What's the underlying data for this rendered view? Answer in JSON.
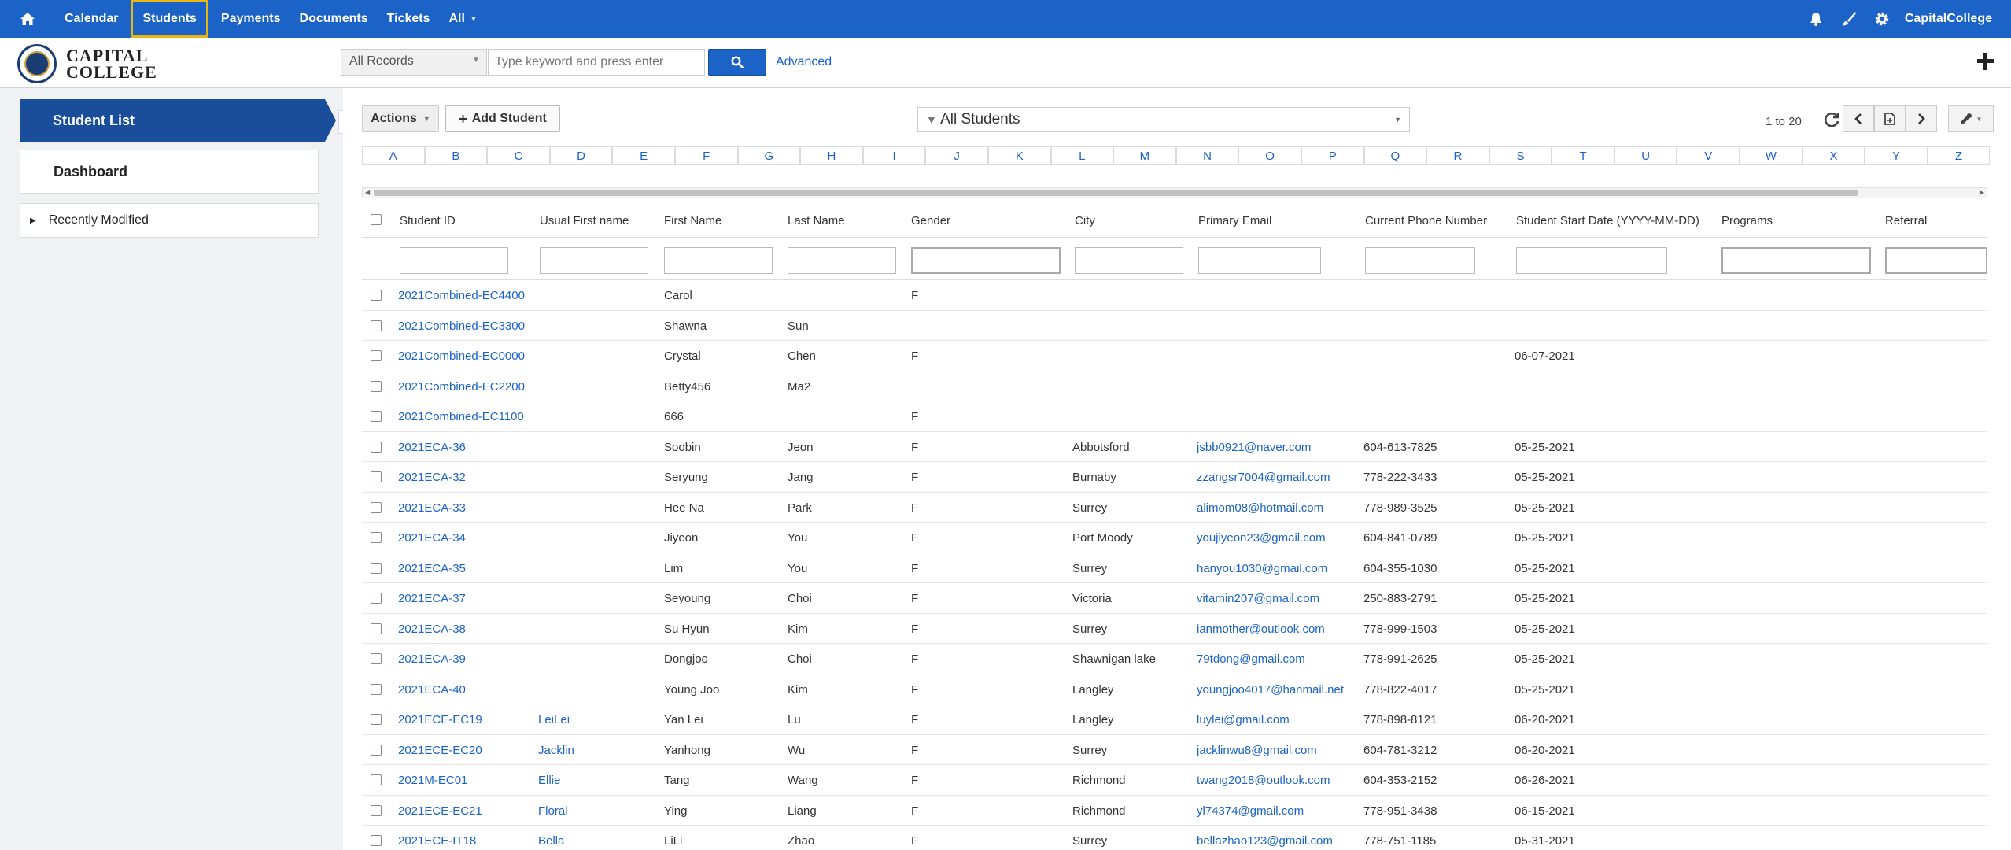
{
  "topnav": {
    "items": [
      {
        "label": "Calendar"
      },
      {
        "label": "Students"
      },
      {
        "label": "Payments"
      },
      {
        "label": "Documents"
      },
      {
        "label": "Tickets"
      },
      {
        "label": "All"
      }
    ],
    "org": "CapitalCollege",
    "active_outline_color": "#e8b512",
    "bar_color": "#1b63c6"
  },
  "logo": {
    "line1": "CAPITAL",
    "line2": "COLLEGE"
  },
  "search": {
    "record_type": "All Records",
    "placeholder": "Type keyword and press enter",
    "advanced": "Advanced"
  },
  "sidebar": {
    "active": "Student List",
    "dashboard": "Dashboard",
    "recent": "Recently Modified"
  },
  "toolbar": {
    "actions": "Actions",
    "add": "Add Student",
    "filter": "All Students",
    "range": "1 to 20"
  },
  "letters": [
    "A",
    "B",
    "C",
    "D",
    "E",
    "F",
    "G",
    "H",
    "I",
    "J",
    "K",
    "L",
    "M",
    "N",
    "O",
    "P",
    "Q",
    "R",
    "S",
    "T",
    "U",
    "V",
    "W",
    "X",
    "Y",
    "Z"
  ],
  "columns": {
    "student_id": "Student ID",
    "usual_first": "Usual First name",
    "first": "First Name",
    "last": "Last Name",
    "gender": "Gender",
    "city": "City",
    "email": "Primary Email",
    "phone": "Current Phone Number",
    "start": "Student Start Date (YYYY-MM-DD)",
    "programs": "Programs",
    "referral": "Referral"
  },
  "rows": [
    {
      "id": "2021Combined-EC4400",
      "usual": "",
      "first": "Carol",
      "last": "",
      "gender": "F",
      "city": "",
      "email": "",
      "phone": "",
      "start": ""
    },
    {
      "id": "2021Combined-EC3300",
      "usual": "",
      "first": "Shawna",
      "last": "Sun",
      "gender": "",
      "city": "",
      "email": "",
      "phone": "",
      "start": ""
    },
    {
      "id": "2021Combined-EC0000",
      "usual": "",
      "first": "Crystal",
      "last": "Chen",
      "gender": "F",
      "city": "",
      "email": "",
      "phone": "",
      "start": "06-07-2021"
    },
    {
      "id": "2021Combined-EC2200",
      "usual": "",
      "first": "Betty456",
      "last": "Ma2",
      "gender": "",
      "city": "",
      "email": "",
      "phone": "",
      "start": ""
    },
    {
      "id": "2021Combined-EC1100",
      "usual": "",
      "first": "666",
      "last": "",
      "gender": "F",
      "city": "",
      "email": "",
      "phone": "",
      "start": ""
    },
    {
      "id": "2021ECA-36",
      "usual": "",
      "first": "Soobin",
      "last": "Jeon",
      "gender": "F",
      "city": "Abbotsford",
      "email": "jsbb0921@naver.com",
      "phone": "604-613-7825",
      "start": "05-25-2021"
    },
    {
      "id": "2021ECA-32",
      "usual": "",
      "first": "Seryung",
      "last": "Jang",
      "gender": "F",
      "city": "Burnaby",
      "email": "zzangsr7004@gmail.com",
      "phone": "778-222-3433",
      "start": "05-25-2021"
    },
    {
      "id": "2021ECA-33",
      "usual": "",
      "first": "Hee Na",
      "last": "Park",
      "gender": "F",
      "city": "Surrey",
      "email": "alimom08@hotmail.com",
      "phone": "778-989-3525",
      "start": "05-25-2021"
    },
    {
      "id": "2021ECA-34",
      "usual": "",
      "first": "Jiyeon",
      "last": "You",
      "gender": "F",
      "city": "Port Moody",
      "email": "youjiyeon23@gmail.com",
      "phone": "604-841-0789",
      "start": "05-25-2021"
    },
    {
      "id": "2021ECA-35",
      "usual": "",
      "first": "Lim",
      "last": "You",
      "gender": "F",
      "city": "Surrey",
      "email": "hanyou1030@gmail.com",
      "phone": "604-355-1030",
      "start": "05-25-2021"
    },
    {
      "id": "2021ECA-37",
      "usual": "",
      "first": "Seyoung",
      "last": "Choi",
      "gender": "F",
      "city": "Victoria",
      "email": "vitamin207@gmail.com",
      "phone": "250-883-2791",
      "start": "05-25-2021"
    },
    {
      "id": "2021ECA-38",
      "usual": "",
      "first": "Su Hyun",
      "last": "Kim",
      "gender": "F",
      "city": "Surrey",
      "email": "ianmother@outlook.com",
      "phone": "778-999-1503",
      "start": "05-25-2021"
    },
    {
      "id": "2021ECA-39",
      "usual": "",
      "first": "Dongjoo",
      "last": "Choi",
      "gender": "F",
      "city": "Shawnigan lake",
      "email": "79tdong@gmail.com",
      "phone": "778-991-2625",
      "start": "05-25-2021"
    },
    {
      "id": "2021ECA-40",
      "usual": "",
      "first": "Young Joo",
      "last": "Kim",
      "gender": "F",
      "city": "Langley",
      "email": "youngjoo4017@hanmail.net",
      "phone": "778-822-4017",
      "start": "05-25-2021"
    },
    {
      "id": "2021ECE-EC19",
      "usual": "LeiLei",
      "first": "Yan Lei",
      "last": "Lu",
      "gender": "F",
      "city": "Langley",
      "email": "luylei@gmail.com",
      "phone": "778-898-8121",
      "start": "06-20-2021"
    },
    {
      "id": "2021ECE-EC20",
      "usual": "Jacklin",
      "first": "Yanhong",
      "last": "Wu",
      "gender": "F",
      "city": "Surrey",
      "email": "jacklinwu8@gmail.com",
      "phone": "604-781-3212",
      "start": "06-20-2021"
    },
    {
      "id": "2021M-EC01",
      "usual": "Ellie",
      "first": "Tang",
      "last": "Wang",
      "gender": "F",
      "city": "Richmond",
      "email": "twang2018@outlook.com",
      "phone": "604-353-2152",
      "start": "06-26-2021"
    },
    {
      "id": "2021ECE-EC21",
      "usual": "Floral",
      "first": "Ying",
      "last": "Liang",
      "gender": "F",
      "city": "Richmond",
      "email": "yl74374@gmail.com",
      "phone": "778-951-3438",
      "start": "06-15-2021"
    },
    {
      "id": "2021ECE-IT18",
      "usual": "Bella",
      "first": "LiLi",
      "last": "Zhao",
      "gender": "F",
      "city": "Surrey",
      "email": "bellazhao123@gmail.com",
      "phone": "778-751-1185",
      "start": "05-31-2021"
    }
  ],
  "icons": {
    "home": "home-icon",
    "bell": "bell-icon",
    "brush": "brush-icon",
    "gear": "gear-icon",
    "search": "search-icon",
    "plus": "plus-icon",
    "refresh": "refresh-icon",
    "prev": "chevron-left-icon",
    "next": "chevron-right-icon",
    "export": "export-icon",
    "wrench": "wrench-icon"
  }
}
